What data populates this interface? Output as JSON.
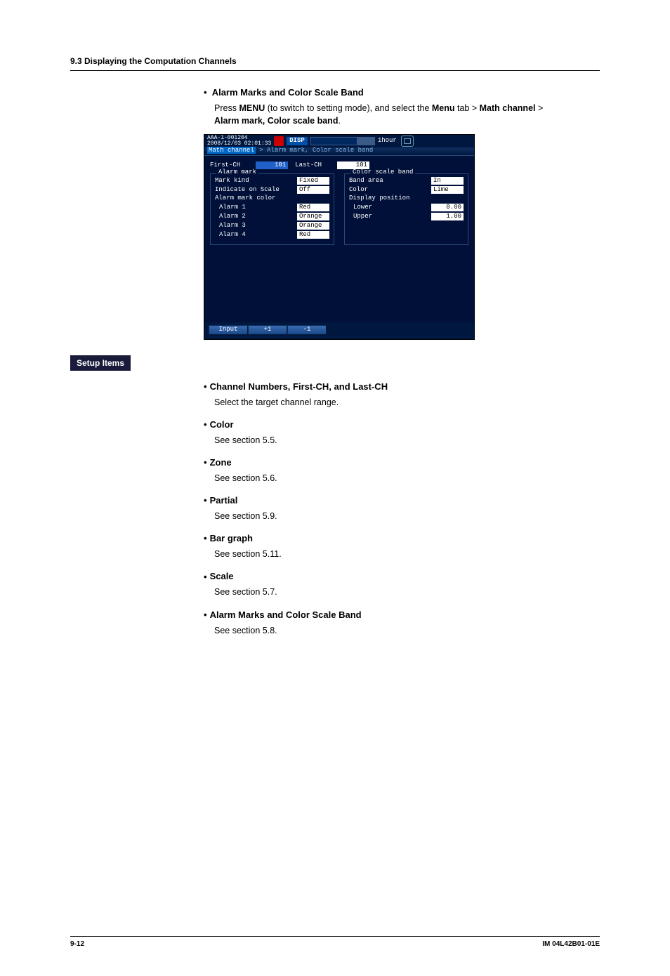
{
  "section_header": "9.3  Displaying the Computation Channels",
  "intro": {
    "title": "Alarm Marks and Color Scale Band",
    "line1_prefix": "Press ",
    "line1_menu": "MENU",
    "line1_mid": " (to switch to setting mode), and select the ",
    "line1_tab": "Menu",
    "line1_mid2": " tab > ",
    "line1_math": "Math channel",
    "line1_gt": " > ",
    "line2": "Alarm mark, Color scale band",
    "line2_suffix": "."
  },
  "screenshot": {
    "id": "AAA-1-001204",
    "datetime": "2008/12/03 02:01:33",
    "mode": "DISP",
    "time_label": "1hour",
    "breadcrumb_active": "Math channel",
    "breadcrumb_path": " > Alarm mark, Color scale band",
    "first_ch_label": "First-CH",
    "first_ch_val": "101",
    "last_ch_label": "Last-CH",
    "last_ch_val": "101",
    "alarm_mark_group": "Alarm mark",
    "alarm_mark": {
      "mark_kind_label": "Mark kind",
      "mark_kind_val": "Fixed",
      "indicate_label": "Indicate on Scale",
      "indicate_val": "Off",
      "color_label": "Alarm mark color",
      "a1_label": "Alarm 1",
      "a1_val": "Red",
      "a2_label": "Alarm 2",
      "a2_val": "Orange",
      "a3_label": "Alarm 3",
      "a3_val": "Orange",
      "a4_label": "Alarm 4",
      "a4_val": "Red"
    },
    "color_band_group": "Color scale band",
    "color_band": {
      "band_area_label": "Band area",
      "band_area_val": "In",
      "color_label": "Color",
      "color_val": "Lime",
      "disp_pos_label": "Display position",
      "lower_label": "Lower",
      "lower_val": "0.00",
      "upper_label": "Upper",
      "upper_val": "1.00"
    },
    "btn_input": "Input",
    "btn_plus": "+1",
    "btn_minus": "-1"
  },
  "setup_items_label": "Setup Items",
  "items": [
    {
      "title": "Channel Numbers, First-CH, and Last-CH",
      "desc": "Select the target channel range."
    },
    {
      "title": "Color",
      "desc": "See section 5.5."
    },
    {
      "title": "Zone",
      "desc": "See section 5.6."
    },
    {
      "title": "Partial",
      "desc": "See section 5.9."
    },
    {
      "title": "Bar graph",
      "desc": "See section 5.11."
    },
    {
      "title": "Scale",
      "desc": "See section 5.7."
    },
    {
      "title": "Alarm Marks and Color Scale Band",
      "desc": "See section 5.8."
    }
  ],
  "footer": {
    "page": "9-12",
    "doc": "IM 04L42B01-01E"
  }
}
